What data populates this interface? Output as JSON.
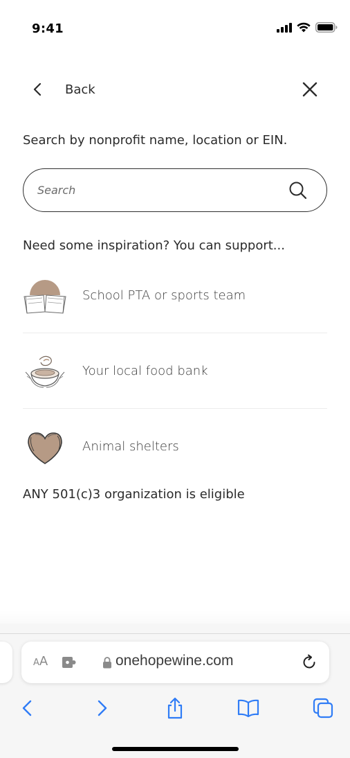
{
  "status_bar": {
    "time": "9:41"
  },
  "nav": {
    "back_label": "Back"
  },
  "search": {
    "heading": "Search by nonprofit name, location or EIN.",
    "placeholder": "Search"
  },
  "inspiration": {
    "heading": "Need some inspiration? You can support...",
    "items": [
      {
        "label": "School PTA or sports team",
        "icon": "book-illustration-icon"
      },
      {
        "label": "Your local food bank",
        "icon": "food-bowl-illustration-icon"
      },
      {
        "label": "Animal shelters",
        "icon": "heart-illustration-icon"
      }
    ]
  },
  "eligibility_note": "ANY 501(c)3 organization is eligible",
  "browser": {
    "aa_small": "A",
    "aa_big": "A",
    "url": "onehopewine.com"
  },
  "colors": {
    "accent_tan": "#b69a85",
    "safari_blue": "#2f7cf6",
    "text_dark": "#2b2b2b"
  }
}
